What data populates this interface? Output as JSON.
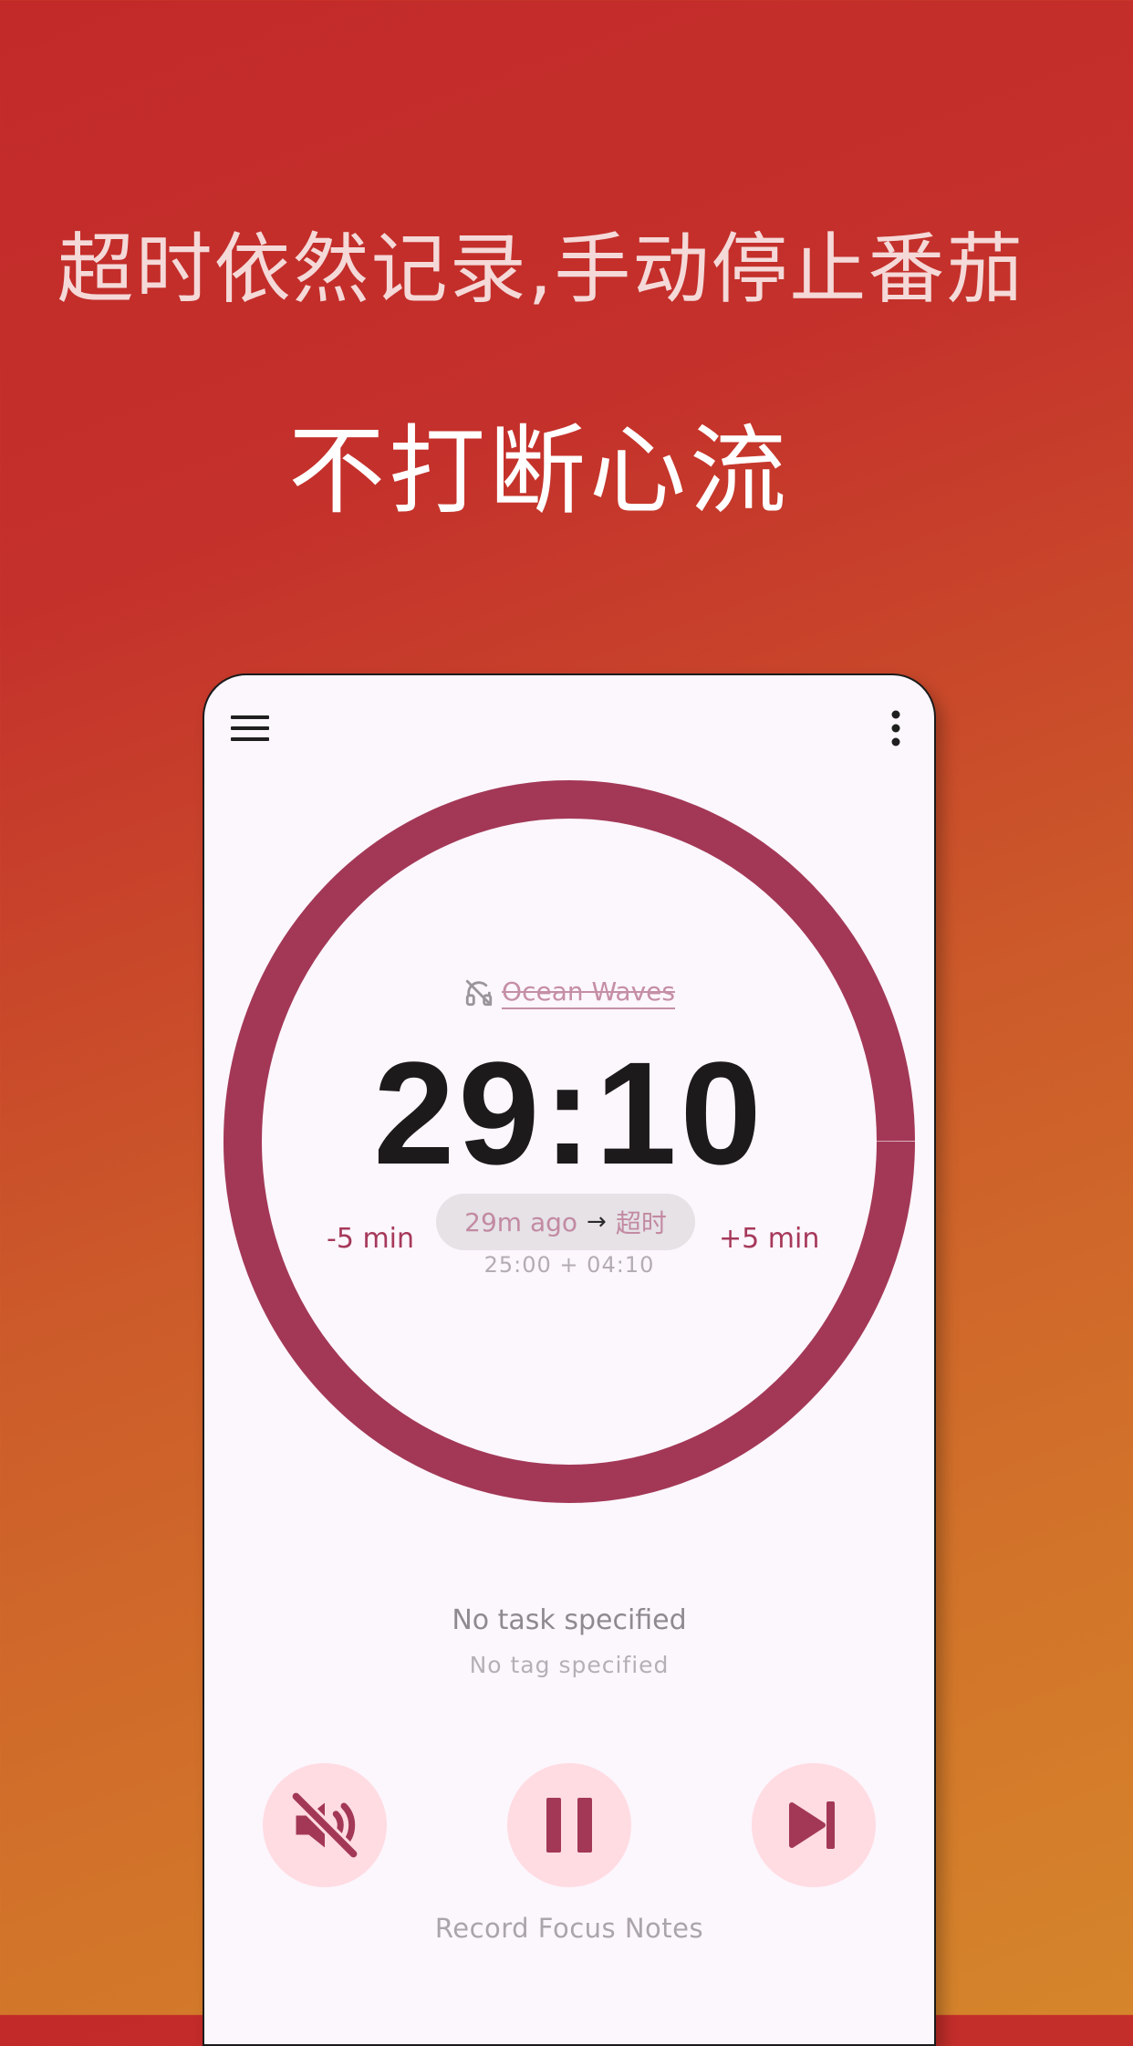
{
  "promo": {
    "headline": "超时依然记录,手动停止番茄",
    "subheadline": "不打断心流"
  },
  "app": {
    "toolbar": {
      "menu_icon": "menu-icon",
      "more_icon": "more-vertical-icon"
    },
    "sound": {
      "icon": "headphones-off-icon",
      "name": "Ocean Waves"
    },
    "timer": {
      "display": "29:10",
      "progress_fraction": 1.0
    },
    "adjust": {
      "minus_label": "-5 min",
      "plus_label": "+5 min"
    },
    "status": {
      "ago": "29m ago",
      "arrow": "→",
      "state": "超时",
      "calculation": "25:00 + 04:10"
    },
    "task": {
      "name": "No task specified",
      "tag": "No tag specified"
    },
    "controls": {
      "mute_icon": "volume-off-icon",
      "pause_icon": "pause-icon",
      "skip_icon": "skip-next-icon"
    },
    "notes_label": "Record Focus Notes",
    "colors": {
      "accent": "#a33856",
      "button_bg": "#ffdce2",
      "surface": "#fcf6fd"
    }
  }
}
